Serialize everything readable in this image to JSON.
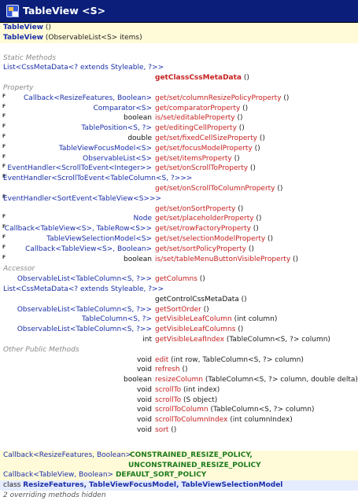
{
  "header": {
    "title": "TableView <S>"
  },
  "constructors": [
    {
      "name": "TableView",
      "args": " ()"
    },
    {
      "name": "TableView",
      "args": " (ObservableList<S> items)"
    }
  ],
  "sections": {
    "static": "Static Methods",
    "property": "Property",
    "accessor": "Accessor",
    "other": "Other Public Methods"
  },
  "static_methods": {
    "type": "List<CssMetaData<? extends Styleable, ?>>",
    "name": "getClassCssMetaData",
    "args": " ()"
  },
  "properties": [
    {
      "type": "Callback<ResizeFeatures, Boolean>",
      "name": "get/set/columnResizePolicyProperty",
      "args": " ()"
    },
    {
      "type": "Comparator<S>",
      "name": "get/comparatorProperty",
      "args": " ()"
    },
    {
      "type": "boolean",
      "name": "is/set/editableProperty",
      "args": " ()"
    },
    {
      "type": "TablePosition<S, ?>",
      "name": "get/editingCellProperty",
      "args": " ()"
    },
    {
      "type": "double",
      "name": "get/set/fixedCellSizeProperty",
      "args": " ()"
    },
    {
      "type": "TableViewFocusModel<S>",
      "name": "get/set/focusModelProperty",
      "args": " ()"
    },
    {
      "type": "ObservableList<S>",
      "name": "get/set/itemsProperty",
      "args": " ()"
    },
    {
      "type": "EventHandler<ScrollToEvent<Integer>>",
      "name": "get/set/onScrollToProperty",
      "args": " ()"
    },
    {
      "type": "EventHandler<ScrollToEvent<TableColumn<S, ?>>>",
      "name": "get/set/onScrollToColumnProperty",
      "args": " ()"
    },
    {
      "type": "EventHandler<SortEvent<TableView<S>>>",
      "name": "get/set/onSortProperty",
      "args": " ()"
    },
    {
      "type": "Node",
      "name": "get/set/placeholderProperty",
      "args": " ()"
    },
    {
      "type": "Callback<TableView<S>, TableRow<S>>",
      "name": "get/set/rowFactoryProperty",
      "args": " ()"
    },
    {
      "type": "TableViewSelectionModel<S>",
      "name": "get/set/selectionModelProperty",
      "args": " ()"
    },
    {
      "type": "Callback<TableView<S>, Boolean>",
      "name": "get/set/sortPolicyProperty",
      "args": " ()"
    },
    {
      "type": "boolean",
      "name": "is/set/tableMenuButtonVisibleProperty",
      "args": " ()"
    }
  ],
  "accessors": [
    {
      "type": "ObservableList<TableColumn<S, ?>>",
      "name": "getColumns",
      "args": " ()"
    },
    {
      "type": "List<CssMetaData<? extends Styleable, ?>>",
      "name": "getControlCssMetaData",
      "args": " ()"
    },
    {
      "type": "ObservableList<TableColumn<S, ?>>",
      "name": "getSortOrder",
      "args": " ()"
    },
    {
      "type": "TableColumn<S, ?>",
      "name": "getVisibleLeafColumn",
      "args": " (int column)"
    },
    {
      "type": "ObservableList<TableColumn<S, ?>>",
      "name": "getVisibleLeafColumns",
      "args": " ()"
    },
    {
      "type": "int",
      "name": "getVisibleLeafIndex",
      "args": " (TableColumn<S, ?> column)"
    }
  ],
  "methods": [
    {
      "type": "void",
      "name": "edit",
      "args": " (int row, TableColumn<S, ?> column)"
    },
    {
      "type": "void",
      "name": "refresh",
      "args": " ()"
    },
    {
      "type": "boolean",
      "name": "resizeColumn",
      "args": " (TableColumn<S, ?> column, double delta)"
    },
    {
      "type": "void",
      "name": "scrollTo",
      "args": " (int index)"
    },
    {
      "type": "void",
      "name": "scrollTo",
      "args": " (S object)"
    },
    {
      "type": "void",
      "name": "scrollToColumn",
      "args": " (TableColumn<S, ?> column)"
    },
    {
      "type": "void",
      "name": "scrollToColumnIndex",
      "args": " (int columnIndex)"
    },
    {
      "type": "void",
      "name": "sort",
      "args": " ()"
    }
  ],
  "fields": [
    {
      "type": "Callback<ResizeFeatures, Boolean>",
      "name1": "CONSTRAINED_RESIZE_POLICY,",
      "name2": "UNCONSTRAINED_RESIZE_POLICY"
    },
    {
      "type": "Callback<TableView, Boolean>",
      "name1": "DEFAULT_SORT_POLICY"
    }
  ],
  "nested": {
    "prefix": "class ",
    "list": "ResizeFeatures, TableViewFocusModel, TableViewSelectionModel"
  },
  "footer": {
    "hidden": "2 overriding methods hidden"
  },
  "colors": {
    "title_bar": "#0a1e7a",
    "type": "#1a2fa8",
    "method": "#c62020",
    "field": "#1c7a1c",
    "highlight": "#fffbd9"
  }
}
